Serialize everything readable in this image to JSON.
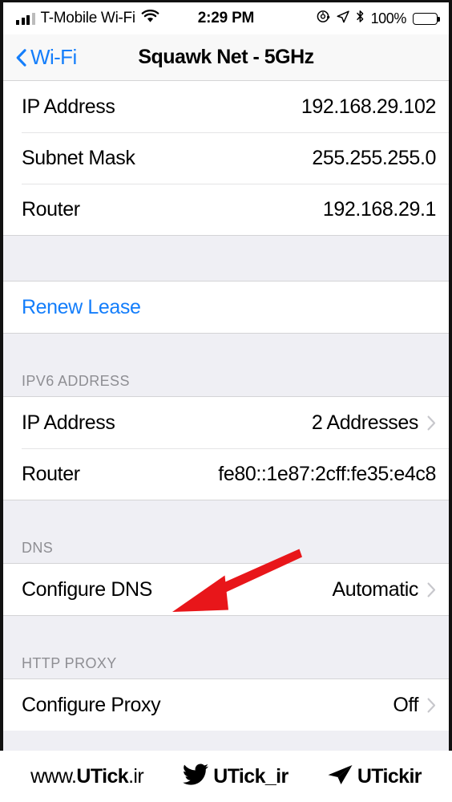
{
  "status_bar": {
    "signal_icon": "signal-bars-icon",
    "carrier": "T-Mobile Wi-Fi",
    "wifi_icon": "wifi-icon",
    "time": "2:29 PM",
    "alarm_icon": "alarm-icon",
    "location_icon": "location-arrow-icon",
    "bluetooth_icon": "bluetooth-icon",
    "battery_percent": "100%",
    "battery_icon": "battery-full-icon"
  },
  "nav_bar": {
    "back_icon": "chevron-left-icon",
    "back_label": "Wi-Fi",
    "title": "Squawk Net - 5GHz"
  },
  "sections": [
    {
      "header": "",
      "rows": [
        {
          "label": "IP Address",
          "value": "192.168.29.102",
          "chevron": false
        },
        {
          "label": "Subnet Mask",
          "value": "255.255.255.0",
          "chevron": false
        },
        {
          "label": "Router",
          "value": "192.168.29.1",
          "chevron": false
        }
      ]
    },
    {
      "header": "",
      "rows": [
        {
          "label": "Renew Lease",
          "value": "",
          "chevron": false,
          "link": true
        }
      ]
    },
    {
      "header": "IPV6 ADDRESS",
      "rows": [
        {
          "label": "IP Address",
          "value": "2 Addresses",
          "chevron": true
        },
        {
          "label": "Router",
          "value": "fe80::1e87:2cff:fe35:e4c8",
          "chevron": false
        }
      ]
    },
    {
      "header": "DNS",
      "rows": [
        {
          "label": "Configure DNS",
          "value": "Automatic",
          "chevron": true
        }
      ]
    },
    {
      "header": "HTTP PROXY",
      "rows": [
        {
          "label": "Configure Proxy",
          "value": "Off",
          "chevron": true
        }
      ]
    }
  ],
  "annotation": {
    "arrow_icon": "red-arrow-pointing-to-configure-dns",
    "color": "#E8161A",
    "points_to": "Configure DNS"
  },
  "footer": {
    "website": "www.UTick.ir",
    "website_plain_prefix": "www.",
    "website_bold": "UTick",
    "website_suffix": ".ir",
    "twitter_icon": "twitter-bird-icon",
    "twitter_handle": "UTick_ir",
    "telegram_icon": "telegram-plane-icon",
    "telegram_handle": "UTickir"
  },
  "colors": {
    "accent_blue": "#147EFB",
    "group_background": "#EFEFF4",
    "chevron_gray": "#C7C7CC",
    "header_gray": "#8E8E93",
    "arrow_red": "#E8161A"
  }
}
